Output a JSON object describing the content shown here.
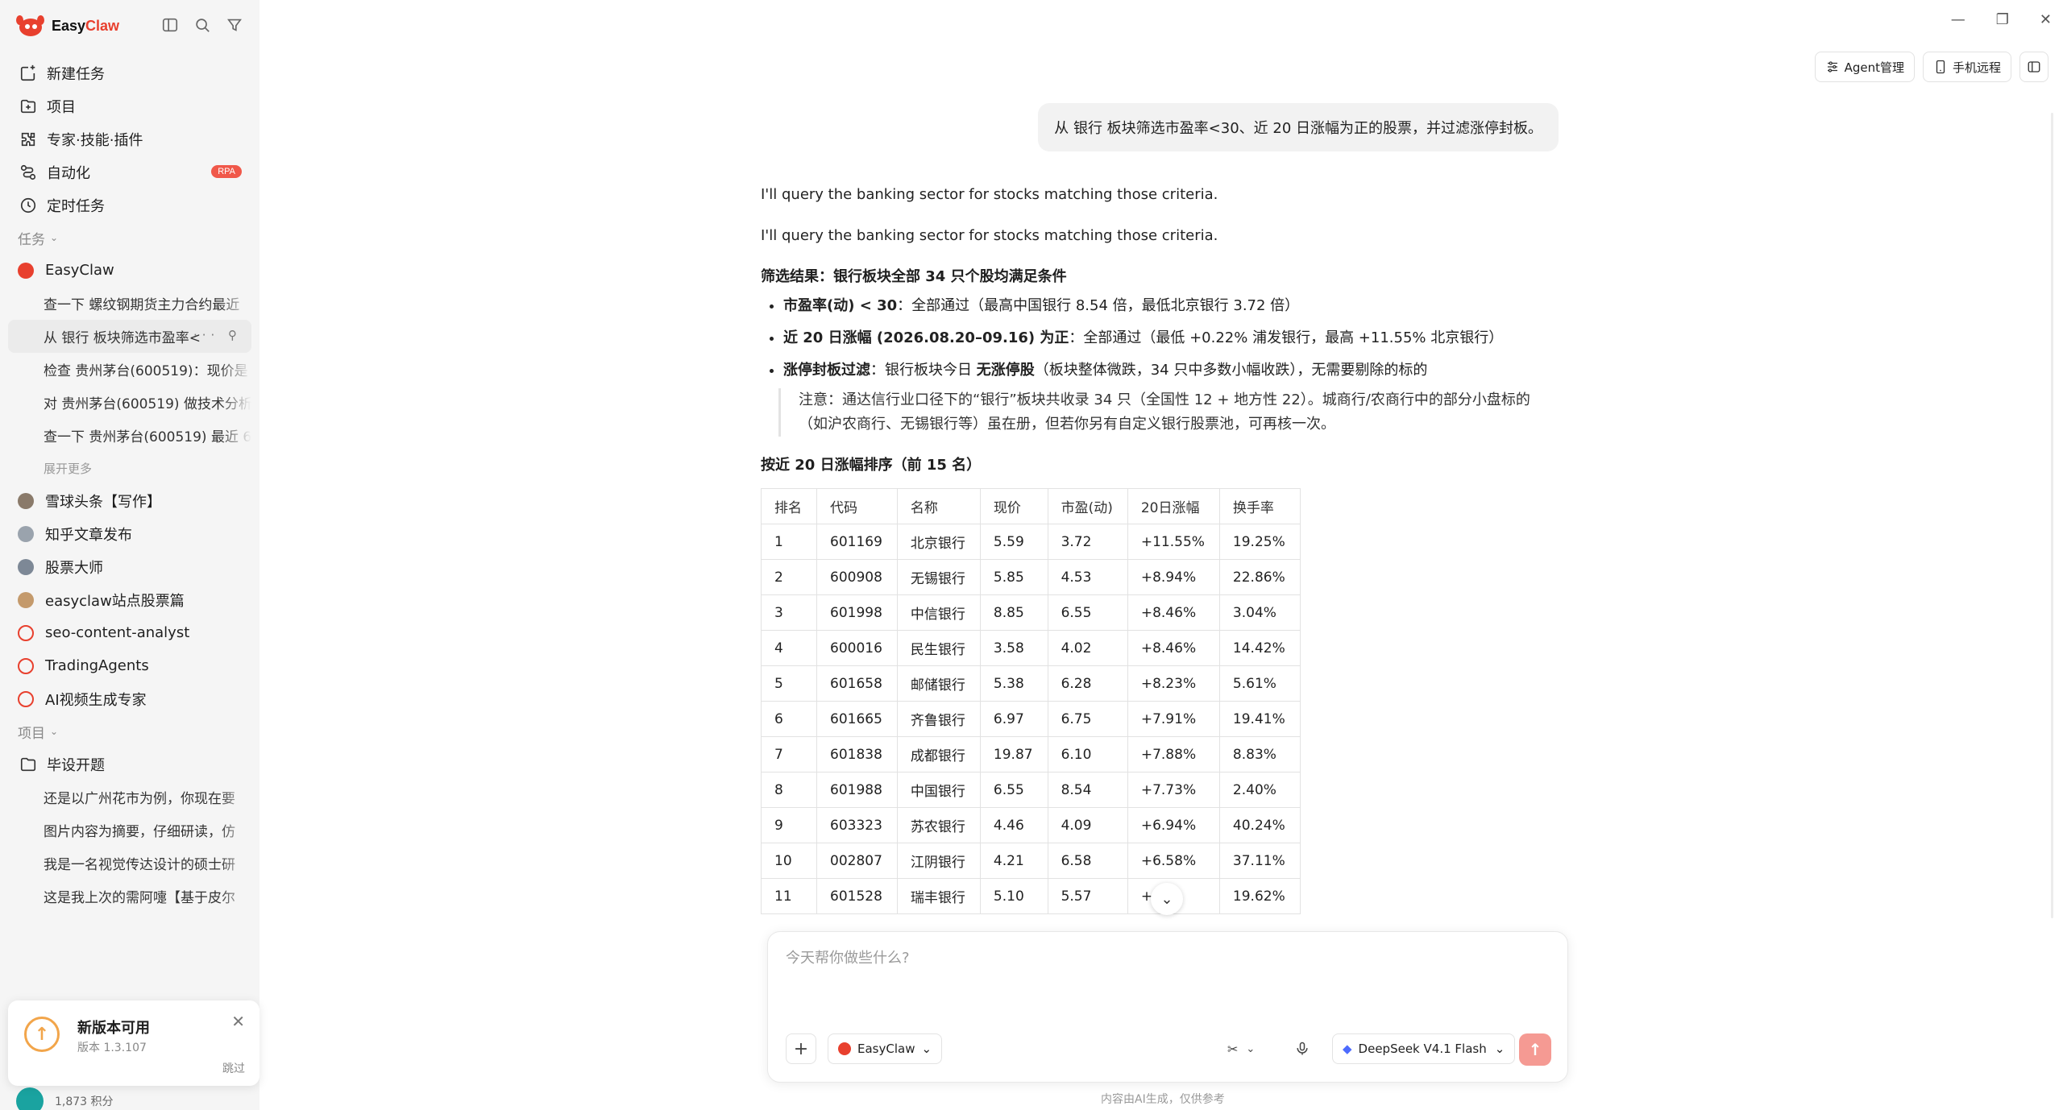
{
  "app": {
    "name_part1": "Easy",
    "name_part2": "Claw"
  },
  "nav": [
    {
      "label": "新建任务",
      "icon": "new-task-icon"
    },
    {
      "label": "项目",
      "icon": "project-icon"
    },
    {
      "label": "专家·技能·插件",
      "icon": "plugin-icon"
    },
    {
      "label": "自动化",
      "icon": "automation-icon",
      "badge": "RPA"
    },
    {
      "label": "定时任务",
      "icon": "clock-icon"
    }
  ],
  "tasks_section": {
    "title": "任务",
    "group": "EasyClaw",
    "items": [
      "查一下 螺纹钢期货主力合约最近",
      "从 银行 板块筛选市盈率<",
      "检查 贵州茅台(600519)：现价是",
      "对 贵州茅台(600519) 做技术分析",
      "查一下 贵州茅台(600519) 最近 6"
    ],
    "more": "展开更多"
  },
  "agents": [
    "雪球头条【写作】",
    "知乎文章发布",
    "股票大师",
    "easyclaw站点股票篇",
    "seo-content-analyst",
    "TradingAgents",
    "AI视频生成专家"
  ],
  "projects_section": {
    "title": "项目",
    "folder": "毕设开题",
    "items": [
      "还是以广州花市为例，你现在要",
      "图片内容为摘要，仔细研读，仿",
      "我是一名视觉传达设计的硕士研",
      "这是我上次的需阿嚏【基于皮尔"
    ]
  },
  "update_toast": {
    "title": "新版本可用",
    "version": "版本 1.3.107",
    "skip": "跳过"
  },
  "user": {
    "points": "1,873 积分"
  },
  "header": {
    "agent_mgmt": "Agent管理",
    "mobile_remote": "手机远程"
  },
  "chat": {
    "user_message": "从 银行 板块筛选市盈率<30、近 20 日涨幅为正的股票，并过滤涨停封板。",
    "reply_line1": "I'll query the banking sector for stocks matching those criteria.",
    "reply_line2": "I'll query the banking sector for stocks matching those criteria.",
    "result_heading": "筛选结果：银行板块全部 34 只个股均满足条件",
    "bullets": [
      {
        "bold": "市盈率(动) < 30",
        "text": "：全部通过（最高中国银行 8.54 倍，最低北京银行 3.72 倍）"
      },
      {
        "bold": "近 20 日涨幅 (2026.08.20–09.16) 为正",
        "text": "：全部通过（最低 +0.22% 浦发银行，最高 +11.55% 北京银行）"
      },
      {
        "bold": "涨停封板过滤",
        "text_pre": "：银行板块今日 ",
        "bold2": "无涨停股",
        "text": "（板块整体微跌，34 只中多数小幅收跌），无需要剔除的标的"
      }
    ],
    "note": "注意：通达信行业口径下的“银行”板块共收录 34 只（全国性 12 + 地方性 22）。城商行/农商行中的部分小盘标的（如沪农商行、无锡银行等）虽在册，但若你另有自定义银行股票池，可再核一次。",
    "table_title": "按近 20 日涨幅排序（前 15 名）",
    "table": {
      "headers": [
        "排名",
        "代码",
        "名称",
        "现价",
        "市盈(动)",
        "20日涨幅",
        "换手率"
      ],
      "rows": [
        [
          "1",
          "601169",
          "北京银行",
          "5.59",
          "3.72",
          "+11.55%",
          "19.25%"
        ],
        [
          "2",
          "600908",
          "无锡银行",
          "5.85",
          "4.53",
          "+8.94%",
          "22.86%"
        ],
        [
          "3",
          "601998",
          "中信银行",
          "8.85",
          "6.55",
          "+8.46%",
          "3.04%"
        ],
        [
          "4",
          "600016",
          "民生银行",
          "3.58",
          "4.02",
          "+8.46%",
          "14.42%"
        ],
        [
          "5",
          "601658",
          "邮储银行",
          "5.38",
          "6.28",
          "+8.23%",
          "5.61%"
        ],
        [
          "6",
          "601665",
          "齐鲁银行",
          "6.97",
          "6.75",
          "+7.91%",
          "19.41%"
        ],
        [
          "7",
          "601838",
          "成都银行",
          "19.87",
          "6.10",
          "+7.88%",
          "8.83%"
        ],
        [
          "8",
          "601988",
          "中国银行",
          "6.55",
          "8.54",
          "+7.73%",
          "2.40%"
        ],
        [
          "9",
          "603323",
          "苏农银行",
          "4.46",
          "4.09",
          "+6.94%",
          "40.24%"
        ],
        [
          "10",
          "002807",
          "江阴银行",
          "4.21",
          "6.58",
          "+6.58%",
          "37.11%"
        ],
        [
          "11",
          "601528",
          "瑞丰银行",
          "5.10",
          "5.57",
          "+6.4",
          "19.62%"
        ]
      ]
    }
  },
  "composer": {
    "placeholder": "今天帮你做些什么?",
    "agent": "EasyClaw",
    "model": "DeepSeek V4.1 Flash",
    "disclaimer": "内容由AI生成，仅供参考"
  }
}
